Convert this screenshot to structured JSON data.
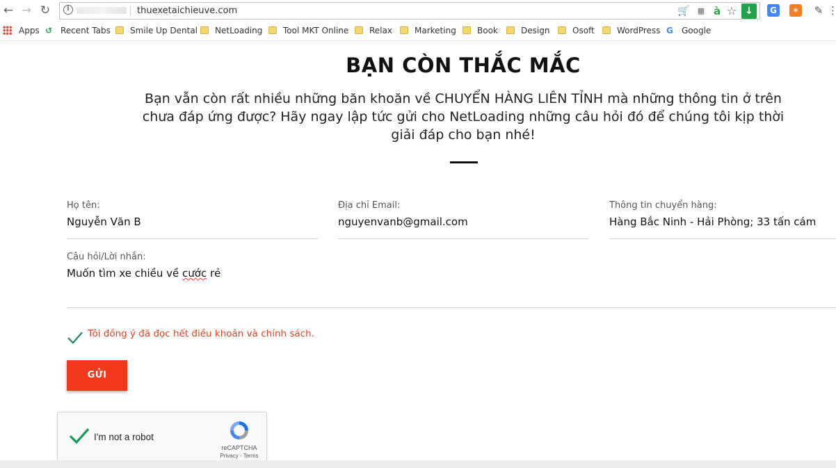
{
  "browser": {
    "url": "thuexetaichieuve.com",
    "bookmarks": [
      {
        "label": "Apps",
        "icon": "apps-grid-icon"
      },
      {
        "label": "Recent Tabs",
        "icon": "history-icon"
      },
      {
        "label": "Smile Up Dental",
        "icon": "folder-icon"
      },
      {
        "label": "NetLoading",
        "icon": "folder-icon"
      },
      {
        "label": "Tool MKT Online",
        "icon": "folder-icon"
      },
      {
        "label": "Relax",
        "icon": "folder-icon"
      },
      {
        "label": "Marketing",
        "icon": "folder-icon"
      },
      {
        "label": "Book",
        "icon": "folder-icon"
      },
      {
        "label": "Design",
        "icon": "folder-icon"
      },
      {
        "label": "Osoft",
        "icon": "folder-icon"
      },
      {
        "label": "WordPress",
        "icon": "folder-icon"
      },
      {
        "label": "Google",
        "icon": "google-icon"
      }
    ]
  },
  "page": {
    "title": "BẠN CÒN THẮC MẮC",
    "description": "Bạn vẫn còn rất nhiều những băn khoăn về CHUYỂN HÀNG LIÊN TỈNH mà những thông tin ở trên chưa đáp ứng được? Hãy ngay lập tức gửi cho NetLoading những câu hỏi đó để chúng tôi kịp thời giải đáp cho bạn nhé!"
  },
  "form": {
    "name": {
      "label": "Họ tên:",
      "value": "Nguyễn Văn B"
    },
    "email": {
      "label": "Địa chỉ Email:",
      "value": "nguyenvanb@gmail.com"
    },
    "shipping": {
      "label": "Thông tin chuyển hàng:",
      "value": "Hàng Bắc Ninh - Hải Phòng; 33 tấn cám"
    },
    "message": {
      "label": "Câu hỏi/Lời nhắn:",
      "value_prefix": "Muốn tìm xe chiều về ",
      "value_misspelled": "cước",
      "value_suffix": " rẻ"
    },
    "consent": "Tôi đồng ý đã đọc hết điều khoản và chính sách.",
    "submit": "GỬI"
  },
  "captcha": {
    "label": "I'm not a robot",
    "brand": "reCAPTCHA",
    "links": "Privacy - Terms"
  },
  "colors": {
    "accent": "#f0391b",
    "check": "#1a8a6a"
  }
}
